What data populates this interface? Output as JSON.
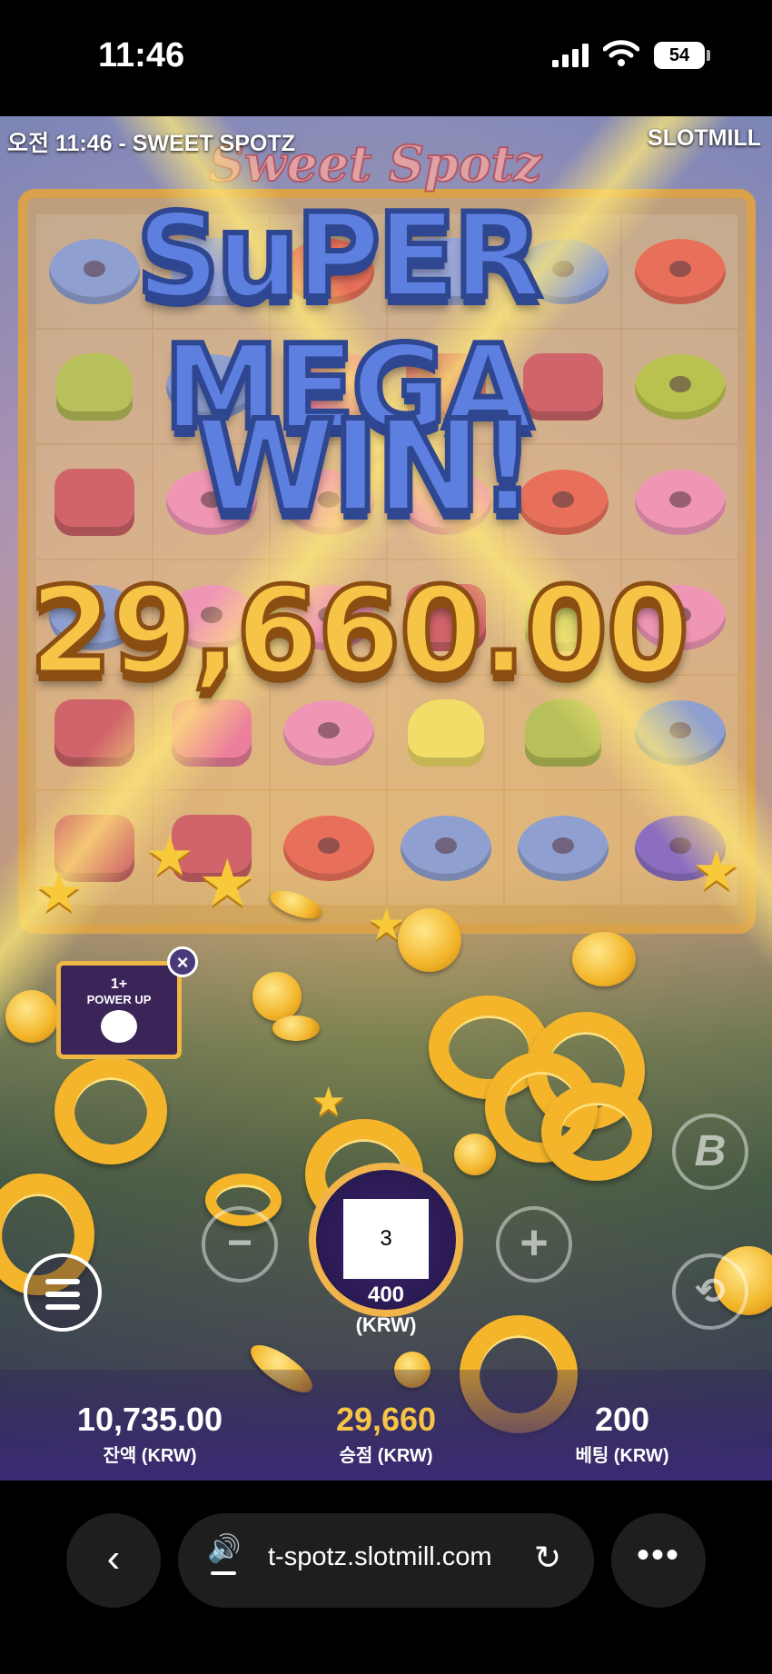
{
  "status_bar": {
    "time": "11:46",
    "battery": "54"
  },
  "game": {
    "header_left": "오전 11:46 - SWEET SPOTZ",
    "header_right": "SLOTMILL",
    "logo": "Sweet Spotz",
    "banner": {
      "line1": "SuPER",
      "line2": "MEGA",
      "line3": "WIN!"
    },
    "win_amount": "29,660.00",
    "powerup": {
      "count": "1+",
      "label": "POWER UP"
    },
    "controls": {
      "minus": "−",
      "plus": "+",
      "boost": "B",
      "spin_count": "3",
      "bet_value": "400",
      "bet_unit": "(KRW)"
    },
    "stats": {
      "balance": {
        "value": "10,735.00",
        "label": "잔액 (KRW)"
      },
      "win": {
        "value": "29,660",
        "label": "승점 (KRW)"
      },
      "bet": {
        "value": "200",
        "label": "베팅 (KRW)"
      }
    },
    "symbols": [
      [
        "donut-blue",
        "candy-blue",
        "donut-red",
        "candy-blue",
        "donut-blue",
        "donut-red"
      ],
      [
        "drop-green",
        "donut-blue",
        "candy-pink",
        "candy-red",
        "candy-red",
        "donut-green"
      ],
      [
        "candy-red",
        "donut-pink",
        "donut-pink",
        "donut-pink",
        "donut-red",
        "donut-pink"
      ],
      [
        "donut-blue",
        "donut-pink",
        "donut-pink",
        "candy-red",
        "drop-green",
        "donut-pink"
      ],
      [
        "candy-red",
        "candy-pink",
        "donut-pink",
        "drop-yellow",
        "drop-green",
        "donut-blue"
      ],
      [
        "candy-red",
        "candy-red",
        "donut-red",
        "donut-blue",
        "donut-blue",
        "donut-purple"
      ]
    ],
    "symbol_colors": {
      "donut-blue": "#8f9fcf",
      "donut-red": "#e8705a",
      "donut-pink": "#ef96b5",
      "donut-green": "#b9c24e",
      "donut-purple": "#8c6ec0",
      "candy-blue": "#9aa6d8",
      "candy-pink": "#ec7f9c",
      "candy-red": "#d0646a",
      "drop-green": "#b7c05a",
      "drop-yellow": "#f1dd67"
    }
  },
  "browser": {
    "url": "t-spotz.slotmill.com",
    "back": "‹",
    "more": "•••",
    "reload": "↻",
    "speaker": "🔊"
  }
}
